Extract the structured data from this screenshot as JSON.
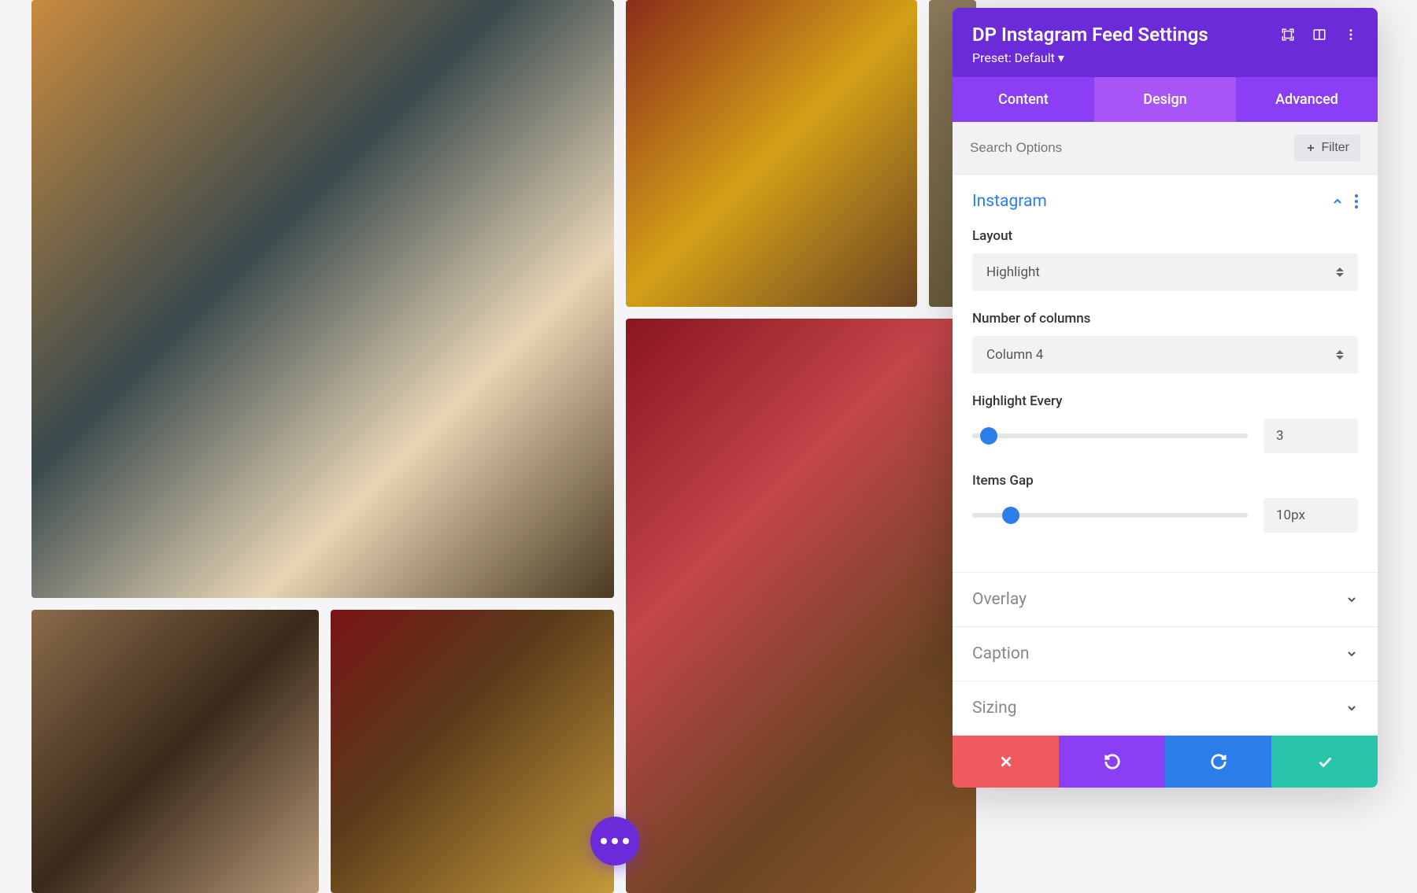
{
  "panel": {
    "title": "DP Instagram Feed Settings",
    "preset_label": "Preset: Default ▾"
  },
  "tabs": {
    "content": "Content",
    "design": "Design",
    "advanced": "Advanced"
  },
  "search": {
    "placeholder": "Search Options",
    "filter_label": "Filter"
  },
  "sections": {
    "instagram": "Instagram",
    "overlay": "Overlay",
    "caption": "Caption",
    "sizing": "Sizing"
  },
  "fields": {
    "layout_label": "Layout",
    "layout_value": "Highlight",
    "columns_label": "Number of columns",
    "columns_value": "Column 4",
    "highlight_label": "Highlight Every",
    "highlight_value": "3",
    "gap_label": "Items Gap",
    "gap_value": "10px"
  }
}
